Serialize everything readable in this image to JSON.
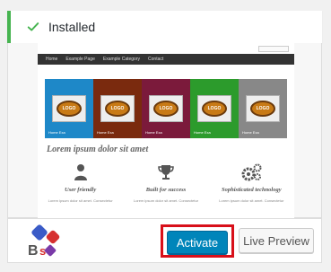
{
  "notice": {
    "text": "Installed"
  },
  "screenshot": {
    "nav": [
      "Home",
      "Example Page",
      "Example Category",
      "Contact"
    ],
    "slide_logo": "LOGO",
    "slide_links": [
      "Home",
      "Exa",
      "Home",
      "Exa",
      "Home",
      "Exa",
      "Home",
      "Exa",
      "Home",
      "Exa"
    ],
    "heading": "Lorem ipsum dolor sit amet",
    "features": [
      {
        "label": "User friendly",
        "desc": "Lorem ipsum dolor sit amet. Consectetur"
      },
      {
        "label": "Built for success",
        "desc": "Lorem ipsum dolor sit amet. Consectetur"
      },
      {
        "label": "Sophisticated technology",
        "desc": "Lorem ipsum dolor sit amet. Consectetur"
      }
    ]
  },
  "actions": {
    "activate": "Activate",
    "live_preview": "Live Preview"
  },
  "colors": {
    "success": "#46b450",
    "primary": "#0085ba",
    "highlight": "#d8101a"
  }
}
